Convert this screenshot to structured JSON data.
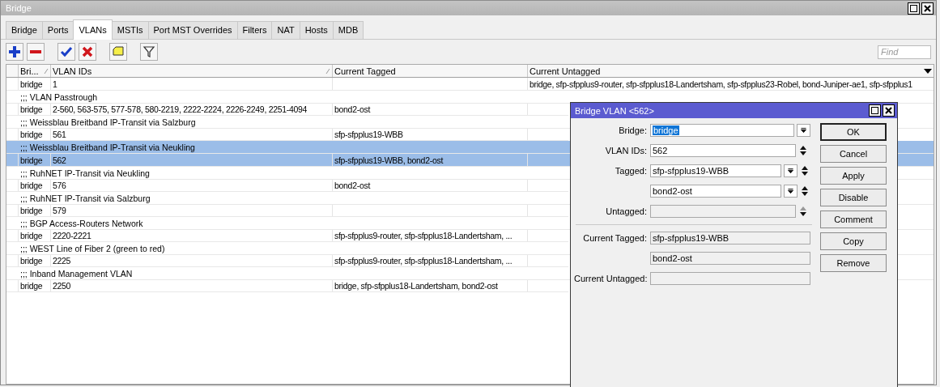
{
  "window": {
    "title": "Bridge"
  },
  "tabs": [
    {
      "label": "Bridge",
      "selected": false
    },
    {
      "label": "Ports",
      "selected": false
    },
    {
      "label": "VLANs",
      "selected": true
    },
    {
      "label": "MSTIs",
      "selected": false
    },
    {
      "label": "Port MST Overrides",
      "selected": false
    },
    {
      "label": "Filters",
      "selected": false
    },
    {
      "label": "NAT",
      "selected": false
    },
    {
      "label": "Hosts",
      "selected": false
    },
    {
      "label": "MDB",
      "selected": false
    }
  ],
  "toolbar": {
    "find_placeholder": "Find"
  },
  "table": {
    "columns": [
      {
        "label": "Bri...",
        "sorted": true
      },
      {
        "label": "VLAN IDs",
        "sorted": true
      },
      {
        "label": "Current Tagged",
        "sorted": false
      },
      {
        "label": "Current Untagged",
        "sorted": false
      }
    ],
    "rows": [
      {
        "kind": "entry",
        "selected": false,
        "cells": [
          "bridge",
          "1",
          "",
          "bridge, sfp-sfpplus9-router, sfp-sfpplus18-Landertsham, sfp-sfpplus23-Robel, bond-Juniper-ae1, sfp-sfpplus1"
        ]
      },
      {
        "kind": "comment",
        "selected": false,
        "text": ";;; VLAN Passtrough"
      },
      {
        "kind": "entry",
        "selected": false,
        "cells": [
          "bridge",
          "2-560, 563-575, 577-578, 580-2219, 2222-2224, 2226-2249, 2251-4094",
          "bond2-ost",
          ""
        ]
      },
      {
        "kind": "comment",
        "selected": false,
        "text": ";;; Weissblau Breitband IP-Transit via Salzburg"
      },
      {
        "kind": "entry",
        "selected": false,
        "cells": [
          "bridge",
          "561",
          "sfp-sfpplus19-WBB",
          ""
        ]
      },
      {
        "kind": "comment",
        "selected": true,
        "text": ";;; Weissblau Breitband IP-Transit via Neukling"
      },
      {
        "kind": "entry",
        "selected": true,
        "cells": [
          "bridge",
          "562",
          "sfp-sfpplus19-WBB, bond2-ost",
          ""
        ]
      },
      {
        "kind": "comment",
        "selected": false,
        "text": ";;; RuhNET IP-Transit via Neukling"
      },
      {
        "kind": "entry",
        "selected": false,
        "cells": [
          "bridge",
          "576",
          "bond2-ost",
          ""
        ]
      },
      {
        "kind": "comment",
        "selected": false,
        "text": ";;; RuhNET IP-Transit via Salzburg"
      },
      {
        "kind": "entry",
        "selected": false,
        "cells": [
          "bridge",
          "579",
          "",
          ""
        ]
      },
      {
        "kind": "comment",
        "selected": false,
        "text": ";;; BGP Access-Routers Network"
      },
      {
        "kind": "entry",
        "selected": false,
        "cells": [
          "bridge",
          "2220-2221",
          "sfp-sfpplus9-router, sfp-sfpplus18-Landertsham, ...",
          ""
        ]
      },
      {
        "kind": "comment",
        "selected": false,
        "text": ";;; WEST Line of Fiber 2 (green to red)"
      },
      {
        "kind": "entry",
        "selected": false,
        "cells": [
          "bridge",
          "2225",
          "sfp-sfpplus9-router, sfp-sfpplus18-Landertsham, ...",
          ""
        ]
      },
      {
        "kind": "comment",
        "selected": false,
        "text": ";;; Inband Management VLAN"
      },
      {
        "kind": "entry",
        "selected": false,
        "cells": [
          "bridge",
          "2250",
          "bridge, sfp-sfpplus18-Landertsham, bond2-ost",
          ""
        ]
      }
    ]
  },
  "dialog": {
    "title": "Bridge VLAN <562>",
    "fields": [
      {
        "label": "Bridge:",
        "value": "bridge",
        "kind": "select",
        "highlighted": true,
        "disabled": false
      },
      {
        "label": "VLAN IDs:",
        "value": "562",
        "kind": "spin",
        "highlighted": false,
        "disabled": false
      },
      {
        "label": "Tagged:",
        "value": "sfp-sfpplus19-WBB",
        "kind": "select-spin",
        "highlighted": false,
        "disabled": false
      },
      {
        "value": "bond2-ost",
        "kind": "select-spin",
        "highlighted": false,
        "disabled": false
      },
      {
        "label": "Untagged:",
        "kind": "spin",
        "highlighted": false,
        "disabled": true
      },
      {
        "kind": "separator"
      },
      {
        "label": "Current Tagged:",
        "value": "sfp-sfpplus19-WBB",
        "kind": "readonly"
      },
      {
        "value": "bond2-ost",
        "kind": "readonly"
      },
      {
        "label": "Current Untagged:",
        "kind": "readonly"
      }
    ],
    "buttons": [
      {
        "label": "OK",
        "default": true
      },
      {
        "label": "Cancel",
        "default": false
      },
      {
        "label": "Apply",
        "default": false
      },
      {
        "label": "Disable",
        "default": false
      },
      {
        "label": "Comment",
        "default": false
      },
      {
        "label": "Copy",
        "default": false
      },
      {
        "label": "Remove",
        "default": false
      }
    ]
  }
}
